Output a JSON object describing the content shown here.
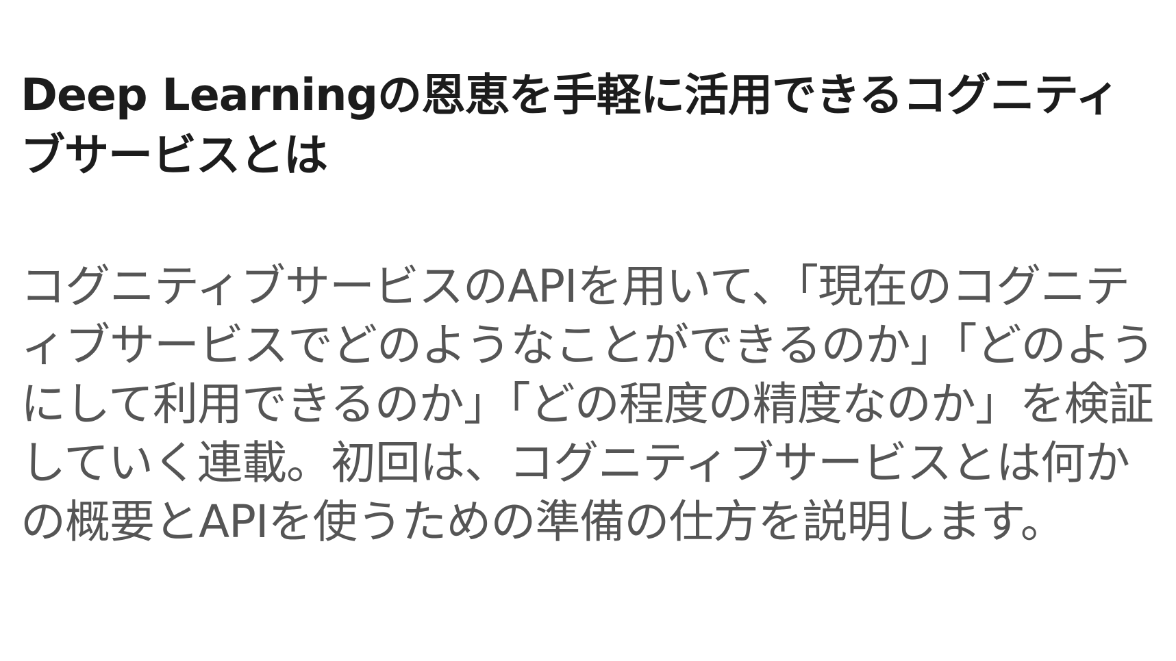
{
  "article": {
    "title": "Deep Learningの恩恵を手軽に活用できるコグニティブサービスとは",
    "body": "コグニティブサービスのAPIを用いて、「現在のコグニティブサービスでどのようなことができるのか」「どのようにして利用できるのか」「どの程度の精度なのか」を検証していく連載。初回は、コグニティブサービスとは何かの概要とAPIを使うための準備の仕方を説明します。"
  }
}
